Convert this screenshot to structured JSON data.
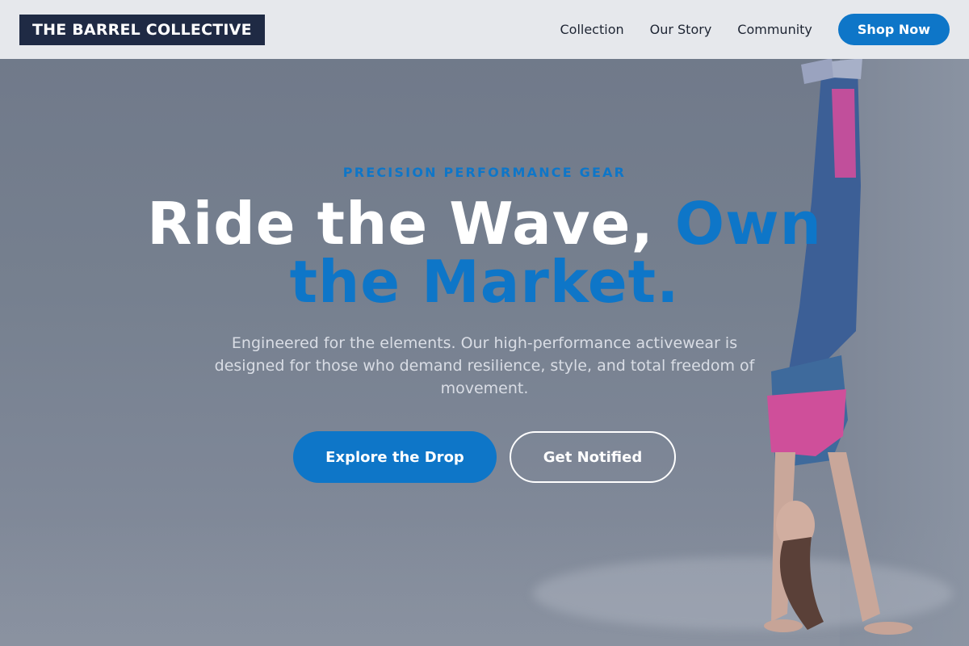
{
  "brand": {
    "logo_text": "THE BARREL COLLECTIVE"
  },
  "nav": {
    "links": [
      "Collection",
      "Our Story",
      "Community"
    ],
    "cta_label": "Shop Now"
  },
  "hero": {
    "eyebrow": "PRECISION PERFORMANCE GEAR",
    "headline_main": "Ride the Wave,",
    "headline_accent": "Own the Market.",
    "subtext": "Engineered for the elements. Our high-performance activewear is designed for those who demand resilience, style, and total freedom of movement.",
    "primary_cta": "Explore the Drop",
    "secondary_cta": "Get Notified"
  },
  "colors": {
    "accent": "#0e76c8",
    "logo_bg": "#1f2a44",
    "nav_bg": "#e6e8ec",
    "overlay": "#7c8596"
  }
}
